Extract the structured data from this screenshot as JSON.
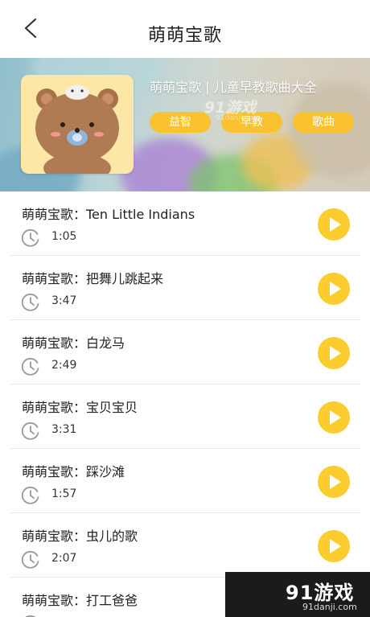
{
  "header": {
    "title": "萌萌宝歌",
    "back_icon": "chevron-left-icon"
  },
  "album": {
    "name": "萌萌宝歌 | 儿童早教歌曲大全",
    "cover_icon": "bear-cover-art",
    "tags": [
      "益智",
      "早教",
      "歌曲"
    ],
    "tag_color": "#f9c22e"
  },
  "watermark": {
    "text": "91游戏",
    "sub": "91danji.com"
  },
  "songs": [
    {
      "title": "萌萌宝歌：Ten Little Indians",
      "duration": "1:05"
    },
    {
      "title": "萌萌宝歌：把舞儿跳起来",
      "duration": "3:47"
    },
    {
      "title": "萌萌宝歌：白龙马",
      "duration": "2:49"
    },
    {
      "title": "萌萌宝歌：宝贝宝贝",
      "duration": "3:31"
    },
    {
      "title": "萌萌宝歌：踩沙滩",
      "duration": "1:57"
    },
    {
      "title": "萌萌宝歌：虫儿的歌",
      "duration": "2:07"
    },
    {
      "title": "萌萌宝歌：打工爸爸",
      "duration": ""
    }
  ],
  "play_color": "#fccb2d",
  "corner_logo": {
    "brand": "91游戏",
    "site": "91danji.com"
  }
}
